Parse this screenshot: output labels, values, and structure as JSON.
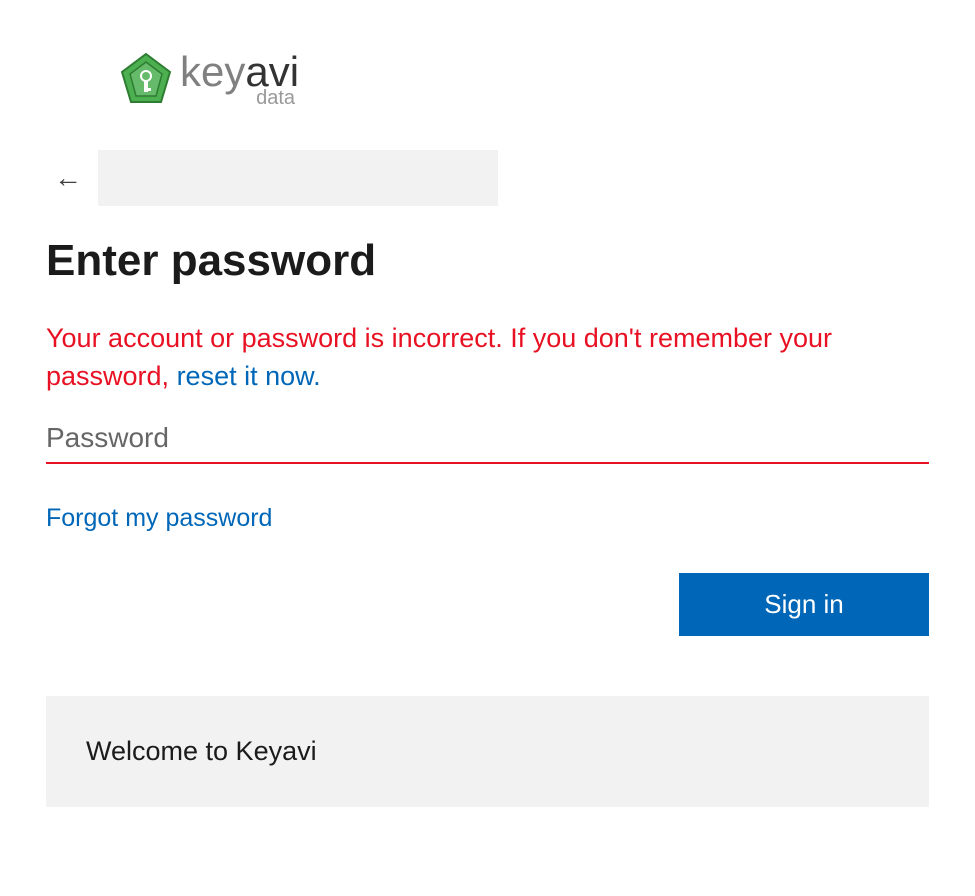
{
  "logo": {
    "brand_part1": "key",
    "brand_part2": "avi",
    "subtitle": "data"
  },
  "heading": "Enter password",
  "error": {
    "message_part1": "Your account or password is incorrect. If you don't remember your password, ",
    "reset_link": "reset it now."
  },
  "password": {
    "placeholder": "Password",
    "value": ""
  },
  "links": {
    "forgot": "Forgot my password"
  },
  "buttons": {
    "signin": "Sign in"
  },
  "footer": {
    "welcome": "Welcome to Keyavi"
  },
  "colors": {
    "primary": "#0067b8",
    "error": "#e81123",
    "logo_green": "#4caf50"
  }
}
